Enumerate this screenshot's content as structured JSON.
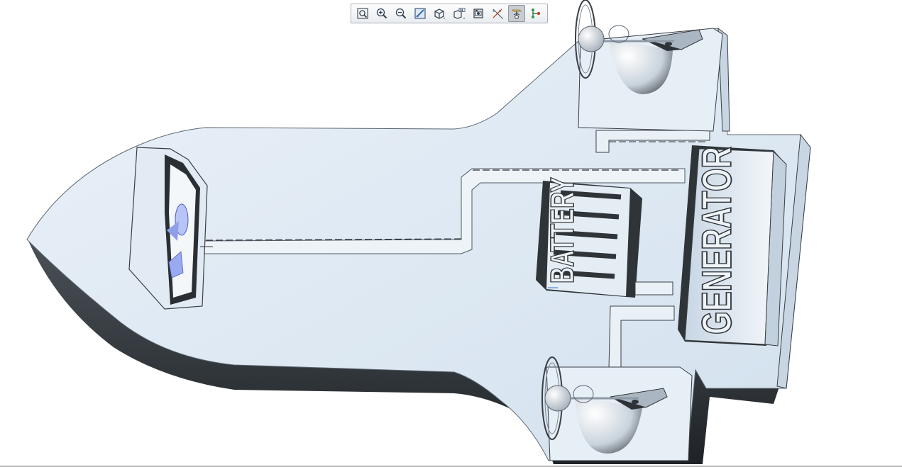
{
  "app": {
    "view": "3d-model-viewport"
  },
  "toolbar": {
    "buttons": [
      {
        "id": "refit",
        "icon": "refit-zoom-icon",
        "active": false
      },
      {
        "id": "zoom-in",
        "icon": "zoom-in-icon",
        "active": false
      },
      {
        "id": "zoom-out",
        "icon": "zoom-out-icon",
        "active": false
      },
      {
        "id": "repaint",
        "icon": "repaint-icon",
        "active": false
      },
      {
        "id": "display-style",
        "icon": "display-style-cube-icon",
        "active": false
      },
      {
        "id": "saved-views",
        "icon": "saved-orientations-icon",
        "active": false
      },
      {
        "id": "view-manager",
        "icon": "view-manager-icon",
        "active": false
      },
      {
        "id": "datum-display",
        "icon": "datum-display-filters-icon",
        "active": false
      },
      {
        "id": "spin-center",
        "icon": "spin-center-icon",
        "active": true
      },
      {
        "id": "annotation-display",
        "icon": "annotation-display-icon",
        "active": false
      }
    ]
  },
  "model": {
    "labels": {
      "battery": "BATTERY",
      "generator": "GENERATOR"
    },
    "colors": {
      "surface": "#d9e6f1",
      "surface_light": "#e6eef6",
      "shadow": "#2e3338",
      "edge": "#3a3f44",
      "accent": "#8f9fe8"
    }
  }
}
